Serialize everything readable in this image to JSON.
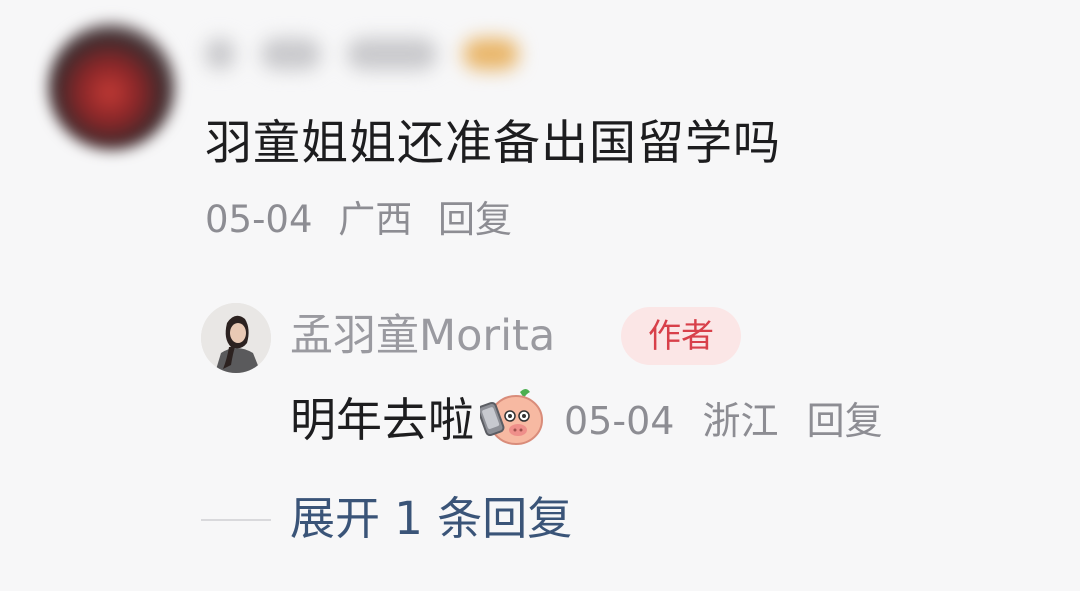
{
  "comment": {
    "text": "羽童姐姐还准备出国留学吗",
    "date": "05-04",
    "location": "广西",
    "reply_label": "回复"
  },
  "reply": {
    "username": "孟羽童Morita",
    "badge": "作者",
    "text": "明年去啦",
    "emoji": "pig-phone-emoji",
    "date": "05-04",
    "location": "浙江",
    "reply_label": "回复"
  },
  "expand": {
    "label": "展开 1 条回复"
  },
  "colors": {
    "background": "#f7f7f8",
    "text_primary": "#1d1d1f",
    "text_meta": "#8d8d93",
    "badge_bg": "#fbe6e6",
    "badge_text": "#d8404a",
    "expand_link": "#3a5478"
  }
}
